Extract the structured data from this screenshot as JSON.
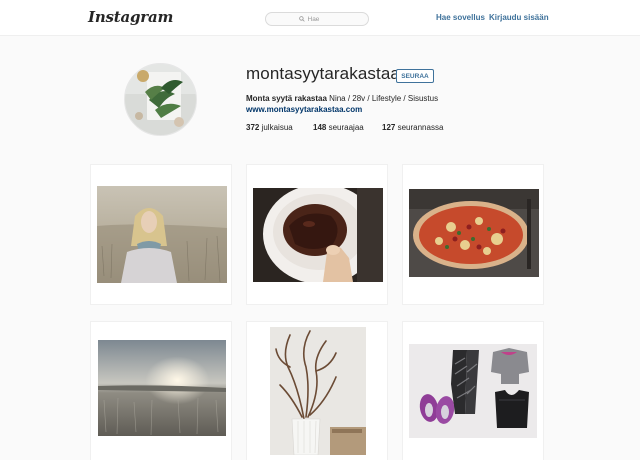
{
  "header": {
    "logo": "Instagram",
    "search_placeholder": "Hae",
    "app_link": "Hae sovellus",
    "login_link": "Kirjaudu sisään"
  },
  "profile": {
    "username": "montasyytarakastaa",
    "follow_label": "SEURAA",
    "bio_name": "Monta syytä rakastaa",
    "bio_text": " Nina / 28v / Lifestyle / Sisustus",
    "website": "www.montasyytarakastaa.com",
    "stats": [
      {
        "count": "372",
        "label": " julkaisua"
      },
      {
        "count": "148",
        "label": " seuraajaa"
      },
      {
        "count": "127",
        "label": " seurannassa"
      }
    ]
  },
  "posts": [
    {
      "icon": "blonde-woman-field-photo"
    },
    {
      "icon": "chocolate-pancake-photo"
    },
    {
      "icon": "pizza-photo"
    },
    {
      "icon": "frosty-sunrise-field-photo"
    },
    {
      "icon": "branches-vase-photo"
    },
    {
      "icon": "sportswear-flatlay-photo"
    }
  ],
  "colors": {
    "link": "#3f729b",
    "background": "#fafafa"
  }
}
